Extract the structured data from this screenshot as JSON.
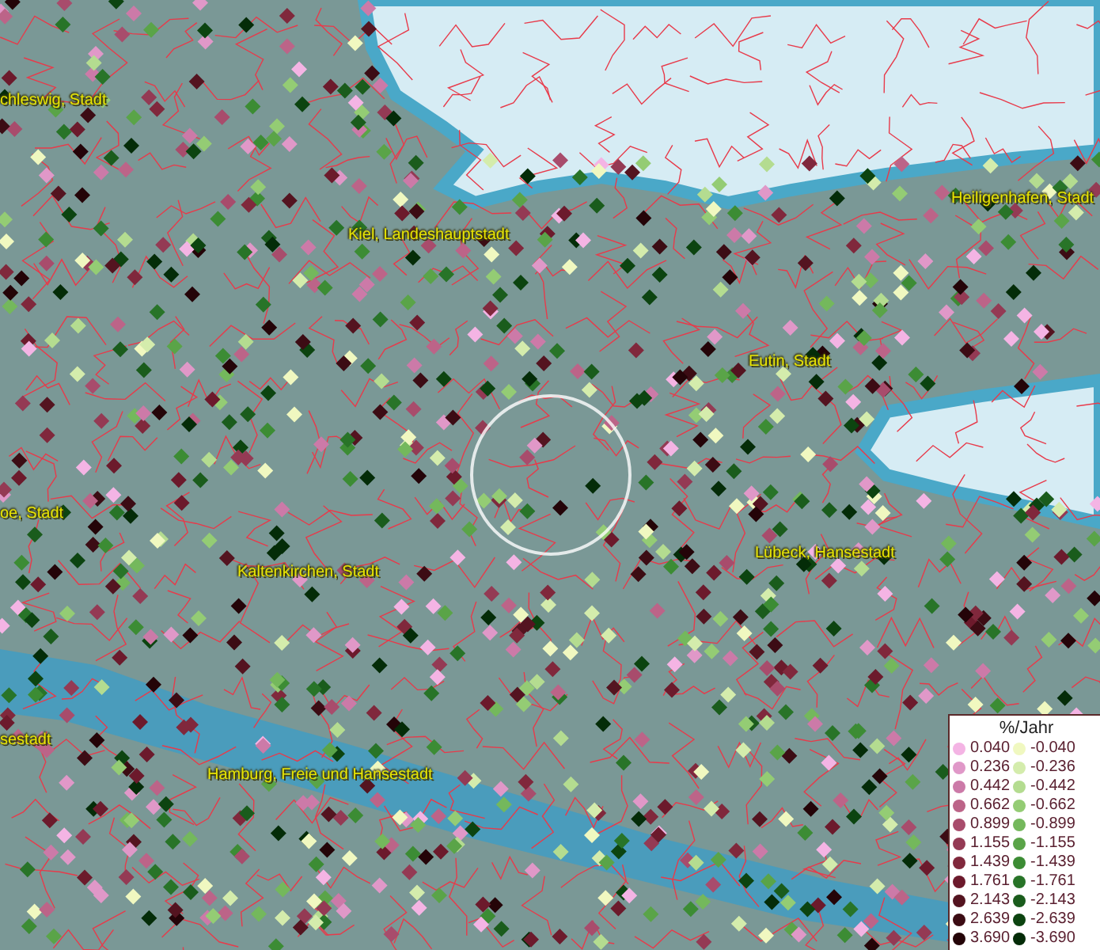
{
  "map_labels": [
    {
      "text": "chleswig, Stadt"
    },
    {
      "text": "Kiel, Landeshauptstadt"
    },
    {
      "text": "Heiligenhafen, Stadt"
    },
    {
      "text": "Eutin, Stadt"
    },
    {
      "text": "oe, Stadt"
    },
    {
      "text": "Kaltenkirchen, Stadt"
    },
    {
      "text": "Lübeck, Hansestadt"
    },
    {
      "text": "sestadt"
    },
    {
      "text": "Hamburg, Freie und Hansestadt"
    }
  ],
  "legend": {
    "title": "%/Jahr",
    "left": [
      {
        "color": "#f4b4e4",
        "label": "0.040"
      },
      {
        "color": "#e098c8",
        "label": "0.236"
      },
      {
        "color": "#cc7aa8",
        "label": "0.442"
      },
      {
        "color": "#bc6488",
        "label": "0.662"
      },
      {
        "color": "#a84c6c",
        "label": "0.899"
      },
      {
        "color": "#943a54",
        "label": "1.155"
      },
      {
        "color": "#80283c",
        "label": "1.439"
      },
      {
        "color": "#6c1a2c",
        "label": "1.761"
      },
      {
        "color": "#541420",
        "label": "2.143"
      },
      {
        "color": "#3c0c14",
        "label": "2.639"
      },
      {
        "color": "#240408",
        "label": "3.690"
      }
    ],
    "right": [
      {
        "color": "#f0f8c0",
        "label": "-0.040"
      },
      {
        "color": "#d4ecac",
        "label": "-0.236"
      },
      {
        "color": "#b4dc90",
        "label": "-0.442"
      },
      {
        "color": "#94cc74",
        "label": "-0.662"
      },
      {
        "color": "#74b85c",
        "label": "-0.899"
      },
      {
        "color": "#5aa448",
        "label": "-1.155"
      },
      {
        "color": "#3c8c34",
        "label": "-1.439"
      },
      {
        "color": "#287428",
        "label": "-1.761"
      },
      {
        "color": "#1a5c1c",
        "label": "-2.143"
      },
      {
        "color": "#0c4410",
        "label": "-2.639"
      },
      {
        "color": "#042c08",
        "label": "-3.690"
      }
    ]
  }
}
